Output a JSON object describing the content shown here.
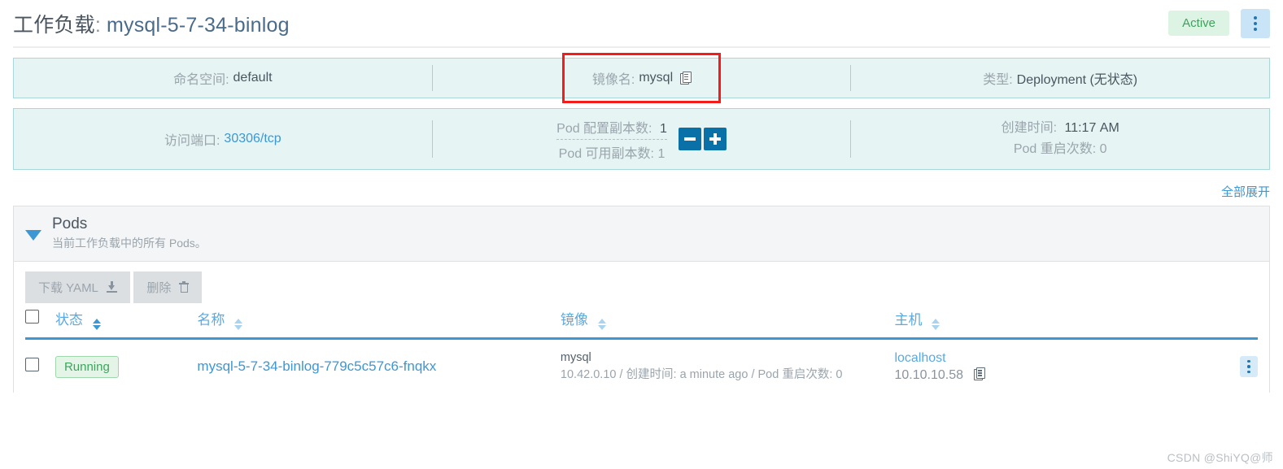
{
  "header": {
    "title_prefix": "工作负载",
    "title_colon": ":",
    "title_value": "mysql-5-7-34-binlog",
    "status_badge": "Active",
    "menu_icon": "kebab-menu-icon"
  },
  "info_row1": [
    {
      "label": "命名空间:",
      "value": "default",
      "highlighted": false
    },
    {
      "label": "镜像名:",
      "value": "mysql",
      "highlighted": true,
      "copy_icon": "clipboard-copy-icon"
    },
    {
      "label": "类型:",
      "value": "Deployment (无状态)",
      "highlighted": false
    }
  ],
  "info_row2": {
    "port_label": "访问端口:",
    "port_value": "30306/tcp",
    "replicas_configured_label": "Pod 配置副本数:",
    "replicas_configured_value": "1",
    "replicas_available_label": "Pod 可用副本数:",
    "replicas_available_value": "1",
    "scale_down_icon": "minus-icon",
    "scale_up_icon": "plus-icon",
    "created_label": "创建时间:",
    "created_value": "11:17 AM",
    "restarts_label": "Pod 重启次数:",
    "restarts_value": "0"
  },
  "expand_all": "全部展开",
  "pods_panel": {
    "title": "Pods",
    "subtitle": "当前工作负载中的所有 Pods。",
    "caret_icon": "caret-down-icon",
    "actions": [
      {
        "label": "下载 YAML",
        "icon": "download-icon"
      },
      {
        "label": "删除",
        "icon": "trash-icon"
      }
    ],
    "columns": [
      {
        "label": "状态",
        "sort": "active"
      },
      {
        "label": "名称",
        "sort": "inactive"
      },
      {
        "label": "镜像",
        "sort": "inactive"
      },
      {
        "label": "主机",
        "sort": "inactive"
      }
    ],
    "rows": [
      {
        "state": "Running",
        "name": "mysql-5-7-34-binlog-779c5c57c6-fnqkx",
        "image_main": "mysql",
        "image_sub": "10.42.0.10 / 创建时间: a minute ago / Pod 重启次数: 0",
        "host_name": "localhost",
        "host_ip": "10.10.10.58",
        "host_copy_icon": "clipboard-copy-icon",
        "row_menu_icon": "kebab-menu-icon"
      }
    ]
  },
  "watermark": "CSDN @ShiYQ@师",
  "colors": {
    "accent_blue": "#3d97d3",
    "card_bg": "#e6f5f4",
    "card_border": "#a8d8da",
    "status_green_bg": "#ddf3e4",
    "status_green_text": "#41a05e",
    "highlight_red": "#f41b1b",
    "scale_button_blue": "#0a70a8"
  }
}
